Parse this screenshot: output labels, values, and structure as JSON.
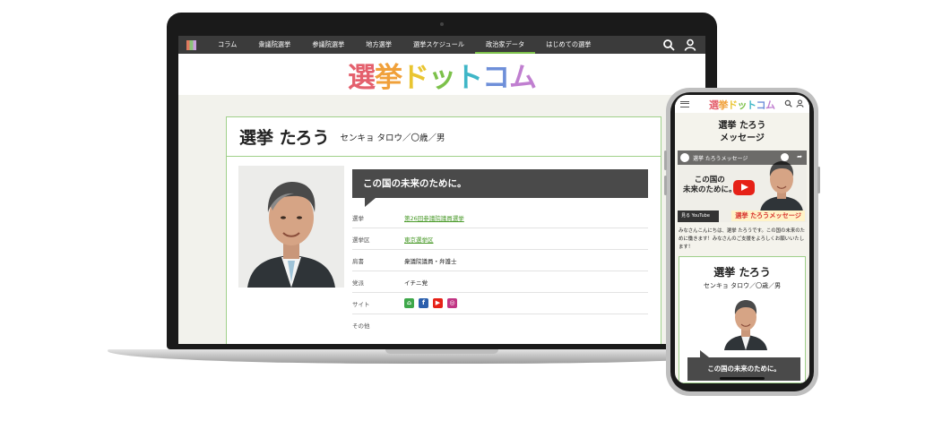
{
  "laptop": {
    "nav": {
      "items": [
        {
          "label": "コラム"
        },
        {
          "label": "衆議院選挙"
        },
        {
          "label": "参議院選挙"
        },
        {
          "label": "地方選挙"
        },
        {
          "label": "選挙スケジュール"
        },
        {
          "label": "政治家データ",
          "active": true
        },
        {
          "label": "はじめての選挙"
        }
      ],
      "icons": [
        "search-icon",
        "user-icon"
      ]
    },
    "brand": [
      "選",
      "挙",
      "ド",
      "ッ",
      "ト",
      "コ",
      "ム"
    ],
    "profile": {
      "name": "選挙 たろう",
      "reading": "センキョ タロウ／〇歳／男",
      "slogan": "この国の未来のために。",
      "rows": [
        {
          "label": "選挙",
          "value": "第26回参議院議員選挙",
          "link": true
        },
        {
          "label": "選挙区",
          "value": "東京選挙区",
          "link": true
        },
        {
          "label": "肩書",
          "value": "衆議院議員・弁護士",
          "link": false
        },
        {
          "label": "党派",
          "value": "イチニ党",
          "link": false
        },
        {
          "label": "サイト",
          "value": "",
          "link": false
        },
        {
          "label": "その他",
          "value": "",
          "link": false
        }
      ],
      "social": [
        {
          "icon": "home-icon",
          "color": "#3ea84a"
        },
        {
          "icon": "facebook-icon",
          "color": "#2b5fad"
        },
        {
          "icon": "youtube-icon",
          "color": "#e62117"
        },
        {
          "icon": "instagram-icon",
          "color": "#c13584"
        }
      ]
    }
  },
  "phone": {
    "brand": [
      "選",
      "挙",
      "ド",
      "ッ",
      "ト",
      "コ",
      "ム"
    ],
    "page_title_line1": "選挙 たろう",
    "page_title_line2": "メッセージ",
    "video": {
      "title": "選挙 たろうメッセージ",
      "thumb_line1": "この国の",
      "thumb_line2": "未来のために。",
      "watch_on": "見る YouTube",
      "banner": "選挙 たろうメッセージ"
    },
    "greeting": "みなさんこんにちは、選挙 たろうです。この国の未来のために働きます！みなさんのご支援をよろしくお願いいたします！",
    "card": {
      "name": "選挙 たろう",
      "reading": "センキョ タロウ／〇歳／男",
      "slogan": "この国の未来のために。"
    }
  }
}
